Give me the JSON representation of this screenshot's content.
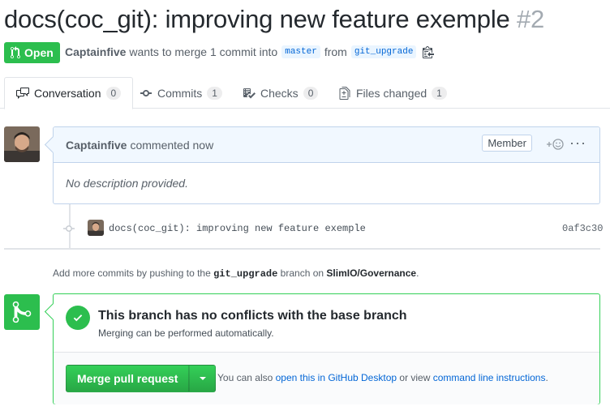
{
  "header": {
    "title": "docs(coc_git): improving new feature exemple",
    "number": "#2",
    "state": "Open",
    "author": "Captainfive",
    "meta_text": "wants to merge 1 commit into",
    "base_branch": "master",
    "from_text": "from",
    "head_branch": "git_upgrade"
  },
  "tabs": [
    {
      "label": "Conversation",
      "count": "0",
      "icon": "comment-discussion-icon"
    },
    {
      "label": "Commits",
      "count": "1",
      "icon": "git-commit-icon"
    },
    {
      "label": "Checks",
      "count": "0",
      "icon": "checklist-icon"
    },
    {
      "label": "Files changed",
      "count": "1",
      "icon": "file-diff-icon"
    }
  ],
  "comment": {
    "author": "Captainfive",
    "action": "commented now",
    "badge": "Member",
    "body": "No description provided."
  },
  "commit": {
    "message": "docs(coc_git): improving new feature exemple",
    "sha": "0af3c30"
  },
  "hint": {
    "prefix": "Add more commits by pushing to the",
    "branch": "git_upgrade",
    "middle": "branch on",
    "repo": "SlimIO/Governance",
    "suffix": "."
  },
  "merge": {
    "status_title": "This branch has no conflicts with the base branch",
    "status_sub": "Merging can be performed automatically.",
    "button_label": "Merge pull request",
    "also_prefix": "You can also",
    "desktop_link": "open this in GitHub Desktop",
    "or_text": "or view",
    "cli_link": "command line instructions",
    "also_suffix": "."
  },
  "colors": {
    "open_green": "#2cbe4e",
    "link_blue": "#0366d6",
    "comment_header": "#f1f8ff"
  }
}
